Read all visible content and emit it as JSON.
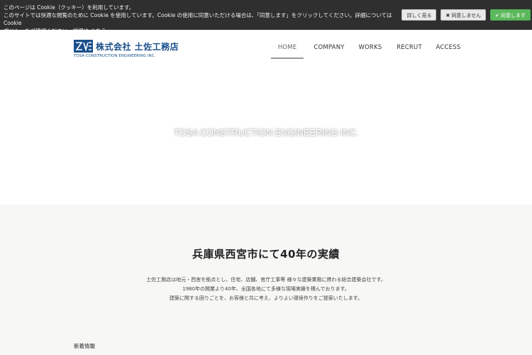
{
  "cookie": {
    "line1": "このページは Cookie（クッキー）を利用しています。",
    "line2": "このサイトでは快適な閲覧のために Cookie を使用しています。Cookie の使用に同意いただける場合は、「同意します」をクリックしてください。詳細については Cookie",
    "line3": "ポリシーをご確認ください。詳細は",
    "link": "こちら",
    "details_label": "詳しく見る",
    "decline_label": "同意しません",
    "accept_label": "同意します"
  },
  "header": {
    "logo_jp": "株式会社 土佐工務店",
    "logo_en": "TOSA CONSTRUCTION ENGINEERING INC.",
    "nav": [
      {
        "label": "HOME"
      },
      {
        "label": "COMPANY"
      },
      {
        "label": "WORKS"
      },
      {
        "label": "RECRUT"
      },
      {
        "label": "ACCESS"
      }
    ]
  },
  "hero": {
    "title": "TOSA CONSTRUCTION ENGINEERING INC."
  },
  "intro": {
    "heading": "兵庫県西宮市にて40年の実績",
    "lines": [
      "土佐工務店は地元・西宮を拠点とし、住宅、店舗、官庁工事等 様々な建築業務に携わる総合建築会社です。",
      "1980年の開業より40年、全国各地にて多様な現場実績を積んでおります。",
      "建築に関する困りごとを、お客様と共に考え、よりよい環境作りをご提案いたします。"
    ],
    "news_label": "新着情報"
  },
  "colors": {
    "brand": "#1a4f8a",
    "cookie_bg": "#2f2f2f",
    "accept": "#5cb85c",
    "section_bg": "#f7f8f6"
  },
  "icons": {
    "decline": "x-icon",
    "accept": "check-icon"
  }
}
